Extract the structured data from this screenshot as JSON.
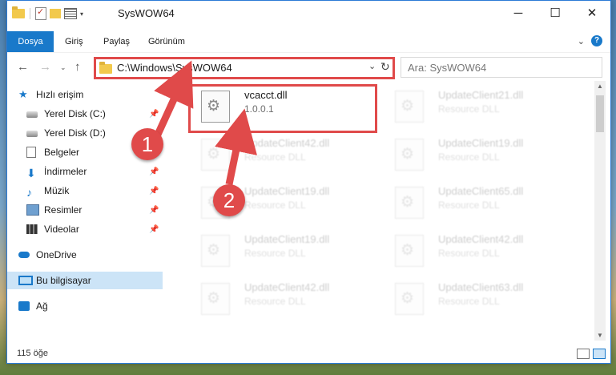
{
  "window": {
    "title": "SysWOW64",
    "controls": {
      "minimize": "─",
      "maximize": "☐",
      "close": "✕"
    }
  },
  "ribbon": {
    "tabs": [
      "Dosya",
      "Giriş",
      "Paylaş",
      "Görünüm"
    ],
    "help": "?"
  },
  "address": {
    "path": "C:\\Windows\\SysWOW64",
    "search_placeholder": "Ara: SysWOW64"
  },
  "nav_pane": {
    "quick_access": "Hızlı erişim",
    "items": [
      {
        "label": "Yerel Disk (C:)",
        "icon": "drive-icon",
        "pinned": true
      },
      {
        "label": "Yerel Disk (D:)",
        "icon": "drive-icon",
        "pinned": false
      },
      {
        "label": "Belgeler",
        "icon": "documents-icon",
        "pinned": true
      },
      {
        "label": "İndirmeler",
        "icon": "downloads-icon",
        "pinned": true
      },
      {
        "label": "Müzik",
        "icon": "music-icon",
        "pinned": true
      },
      {
        "label": "Resimler",
        "icon": "pictures-icon",
        "pinned": true
      },
      {
        "label": "Videolar",
        "icon": "videos-icon",
        "pinned": true
      }
    ],
    "onedrive": "OneDrive",
    "this_pc": "Bu bilgisayar",
    "network": "Ağ"
  },
  "files": [
    {
      "name": "vcacct.dll",
      "sub": "1.0.0.1",
      "highlight": true
    },
    {
      "name": "UpdateClient21.dll",
      "sub": "Resource DLL"
    },
    {
      "name": "UpdateClient42.dll",
      "sub": "Resource DLL"
    },
    {
      "name": "UpdateClient19.dll",
      "sub": "Resource DLL"
    },
    {
      "name": "UpdateClient19.dll",
      "sub": "Resource DLL"
    },
    {
      "name": "UpdateClient65.dll",
      "sub": "Resource DLL"
    },
    {
      "name": "UpdateClient19.dll",
      "sub": "Resource DLL"
    },
    {
      "name": "UpdateClient42.dll",
      "sub": "Resource DLL"
    },
    {
      "name": "UpdateClient42.dll",
      "sub": "Resource DLL"
    },
    {
      "name": "UpdateClient63.dll",
      "sub": "Resource DLL"
    }
  ],
  "status": {
    "count": "115 öğe"
  },
  "annotations": {
    "badge1": "1",
    "badge2": "2",
    "color": "#e04a4a"
  }
}
